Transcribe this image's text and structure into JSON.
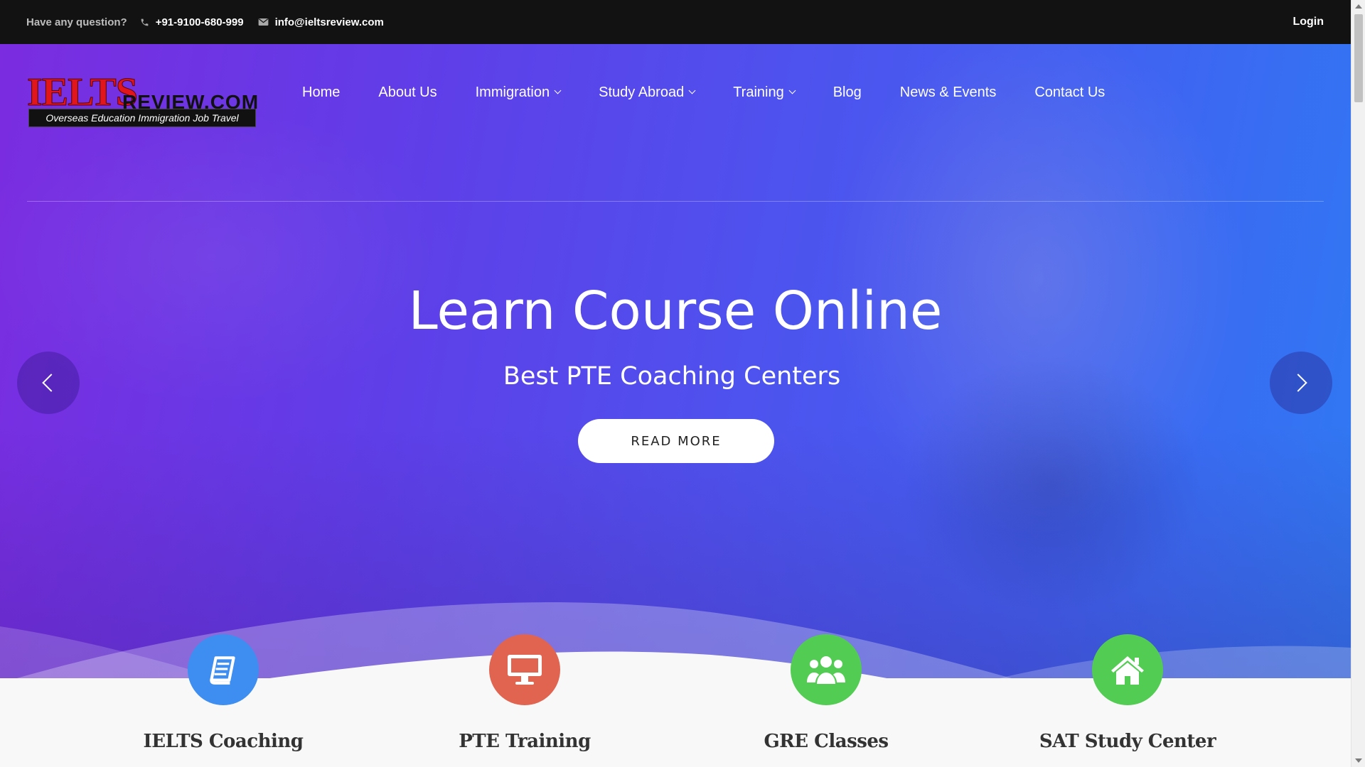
{
  "topbar": {
    "question": "Have any question?",
    "phone": "+91-9100-680-999",
    "email": "info@ieltsreview.com",
    "login": "Login"
  },
  "logo": {
    "primary": "IELTS",
    "secondary": "REVIEW.COM",
    "tagline": "Overseas Education Immigration Job Travel"
  },
  "nav": [
    {
      "label": "Home",
      "dropdown": false
    },
    {
      "label": "About Us",
      "dropdown": false
    },
    {
      "label": "Immigration",
      "dropdown": true
    },
    {
      "label": "Study Abroad",
      "dropdown": true
    },
    {
      "label": "Training",
      "dropdown": true
    },
    {
      "label": "Blog",
      "dropdown": false
    },
    {
      "label": "News & Events",
      "dropdown": false
    },
    {
      "label": "Contact Us",
      "dropdown": false
    }
  ],
  "hero": {
    "title": "Learn Course Online",
    "subtitle": "Best PTE Coaching Centers",
    "button": "READ MORE",
    "prev_icon": "chevron-left-icon",
    "next_icon": "chevron-right-icon"
  },
  "services": [
    {
      "name": "IELTS Coaching",
      "icon": "book-icon",
      "color": "#3d8ef0"
    },
    {
      "name": "PTE Training",
      "icon": "monitor-icon",
      "color": "#e06450"
    },
    {
      "name": "GRE Classes",
      "icon": "users-icon",
      "color": "#52cc52"
    },
    {
      "name": "SAT Study Center",
      "icon": "home-icon",
      "color": "#52cc52"
    }
  ],
  "colors": {
    "topbar_bg": "#121212",
    "hero_start": "#7b2ce0",
    "hero_end": "#2f7af3"
  }
}
